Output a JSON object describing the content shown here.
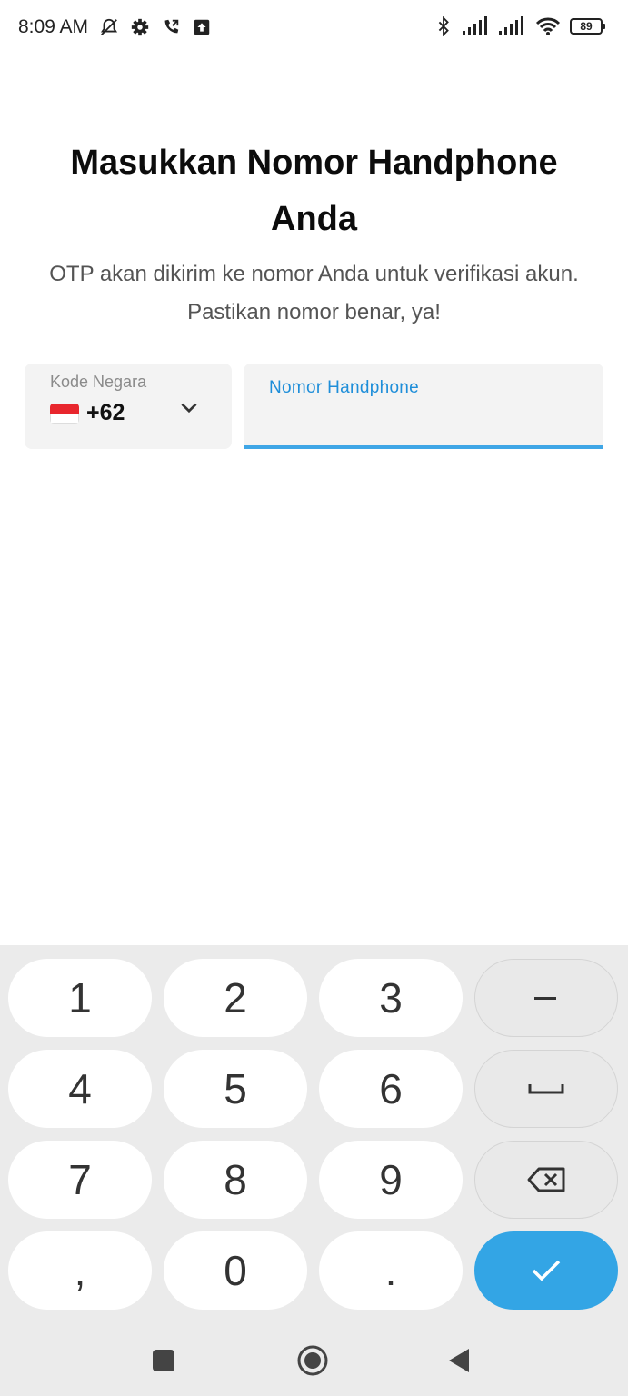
{
  "status_bar": {
    "time": "8:09 AM",
    "battery_level": "89",
    "icons": [
      "bell-off-icon",
      "settings-icon",
      "call-forward-icon",
      "upload-icon",
      "bluetooth-icon",
      "signal-icon",
      "signal-icon",
      "wifi-icon",
      "battery-icon"
    ]
  },
  "header": {
    "title": "Masukkan Nomor Handphone Anda",
    "subtitle": "OTP akan dikirim ke nomor Anda untuk verifikasi akun. Pastikan nomor benar, ya!"
  },
  "country_selector": {
    "label": "Kode Negara",
    "code": "+62",
    "flag": "indonesia-flag-icon"
  },
  "phone_field": {
    "label": "Nomor Handphone",
    "value": ""
  },
  "keypad": {
    "keys": [
      "1",
      "2",
      "3",
      "–",
      "4",
      "5",
      "6",
      "␣",
      "7",
      "8",
      "9",
      "⌫",
      ",",
      "0",
      ".",
      "✓"
    ]
  },
  "colors": {
    "accent": "#33a5e5",
    "field_underline": "#3fa6e6",
    "field_label": "#1e8ed9",
    "field_bg": "#f3f3f3",
    "keyboard_bg": "#ebebeb",
    "flag_red": "#e8262d"
  },
  "nav_bar": {
    "icons": [
      "recents-icon",
      "home-icon",
      "back-icon"
    ]
  }
}
